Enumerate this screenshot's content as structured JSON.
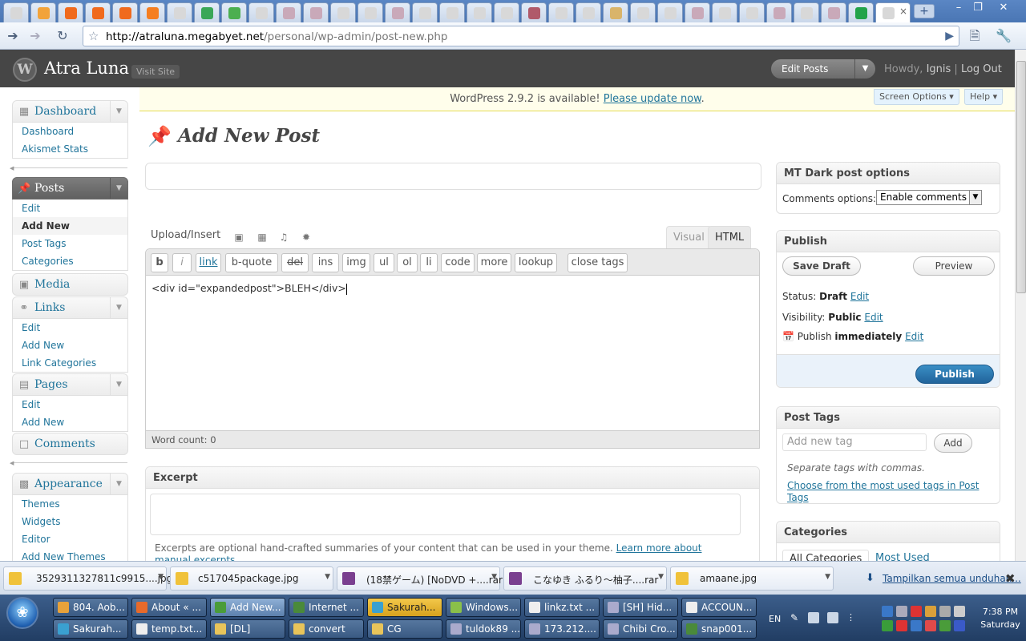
{
  "browser": {
    "url_host": "http://atraluna.megabyet.net",
    "url_path": "/personal/wp-admin/post-new.php",
    "tab_close_glyph": "×",
    "new_tab_glyph": "+"
  },
  "wp_header": {
    "site_name": "Atra Luna",
    "visit_site": "Visit Site",
    "edit_posts": "Edit Posts",
    "howdy_prefix": "Howdy, ",
    "user": "Ignis",
    "separator": " | ",
    "logout": "Log Out"
  },
  "notice": {
    "text": "WordPress 2.9.2 is available! ",
    "link": "Please update now",
    "suffix": "."
  },
  "screen_options": "Screen Options",
  "help": "Help",
  "menu": {
    "dashboard": {
      "label": "Dashboard",
      "items": [
        "Dashboard",
        "Akismet Stats"
      ]
    },
    "posts": {
      "label": "Posts",
      "items": [
        "Edit",
        "Add New",
        "Post Tags",
        "Categories"
      ]
    },
    "media": {
      "label": "Media"
    },
    "links": {
      "label": "Links",
      "items": [
        "Edit",
        "Add New",
        "Link Categories"
      ]
    },
    "pages": {
      "label": "Pages",
      "items": [
        "Edit",
        "Add New"
      ]
    },
    "comments": {
      "label": "Comments"
    },
    "appearance": {
      "label": "Appearance",
      "items": [
        "Themes",
        "Widgets",
        "Editor",
        "Add New Themes"
      ]
    }
  },
  "page_title": "Add New Post",
  "editor": {
    "upload_insert": "Upload/Insert",
    "tab_visual": "Visual",
    "tab_html": "HTML",
    "quicktags": [
      "b",
      "i",
      "link",
      "b-quote",
      "del",
      "ins",
      "img",
      "ul",
      "ol",
      "li",
      "code",
      "more",
      "lookup",
      "close tags"
    ],
    "content": "<div id=\"expandedpost\">BLEH</div>",
    "word_count_label": "Word count: ",
    "word_count": "0"
  },
  "excerpt": {
    "title": "Excerpt",
    "note": "Excerpts are optional hand-crafted summaries of your content that can be used in your theme. ",
    "note_link": "Learn more about manual excerpts."
  },
  "mt_options": {
    "title": "MT Dark post options",
    "comments_label": "Comments options:",
    "comments_value": "Enable comments"
  },
  "publish": {
    "title": "Publish",
    "save_draft": "Save Draft",
    "preview": "Preview",
    "status_label": "Status: ",
    "status_value": "Draft",
    "visibility_label": "Visibility: ",
    "visibility_value": "Public",
    "publish_label": "Publish ",
    "publish_value": "immediately",
    "edit": "Edit",
    "publish_button": "Publish"
  },
  "tags": {
    "title": "Post Tags",
    "placeholder": "Add new tag",
    "add": "Add",
    "hint": "Separate tags with commas.",
    "choose_link": "Choose from the most used tags in Post Tags"
  },
  "categories": {
    "title": "Categories",
    "tab_all": "All Categories",
    "tab_most": "Most Used"
  },
  "downloads": {
    "items": [
      "3529311327811c9915....jpg",
      "c517045package.jpg",
      "(18禁ゲーム) [NoDVD +....rar",
      "こなゆき ふるり〜柚子....rar",
      "amaane.jpg"
    ],
    "show_all": "Tampilkan semua unduhan...",
    "close": "✖"
  },
  "taskbar": {
    "row1": [
      "804. Aob...",
      "About « ...",
      "Add New...",
      "Internet ...",
      "Sakurah...",
      "Windows...",
      "linkz.txt ...",
      "[SH] Hid...",
      "ACCOUN..."
    ],
    "row2": [
      "Sakurah...",
      "temp.txt...",
      "[DL]",
      "convert",
      "CG",
      "tuldok89 ...",
      "173.212....",
      "Chibi Cro...",
      "snap001..."
    ],
    "lang": "EN",
    "time": "7:38 PM",
    "day": "Saturday"
  },
  "colors": {
    "wp_link": "#21759b",
    "wp_header": "#464646",
    "publish_button": "#21649b",
    "notice_bg": "#fffeeb"
  }
}
